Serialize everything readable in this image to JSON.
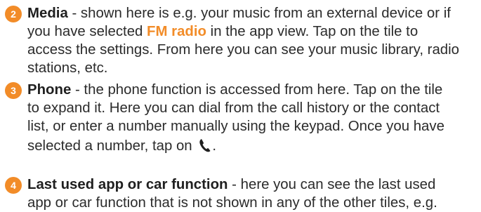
{
  "items": [
    {
      "number": "2",
      "title": "Media",
      "lines": [
        " - shown here is e.g. your music from an external device or if",
        "you have selected ",
        " in the app view. Tap on the tile to",
        "access the settings. From here you can see your music library, radio",
        "stations, etc."
      ],
      "highlight": "FM radio"
    },
    {
      "number": "3",
      "title": "Phone",
      "lines": [
        " - the phone function is accessed from here. Tap on the tile",
        "to expand it. Here you can dial from the call history or the contact",
        "list, or enter a number manually using the keypad. Once you have",
        "selected a number, tap on ",
        "."
      ],
      "icon": "phone-icon"
    },
    {
      "number": "4",
      "title": "Last used app or car function",
      "lines": [
        " - here you can see the last used",
        "app or car function that is not shown in any of the other tiles, e.g."
      ]
    }
  ],
  "colors": {
    "accent": "#f28c28",
    "text": "#2b2b2b"
  }
}
